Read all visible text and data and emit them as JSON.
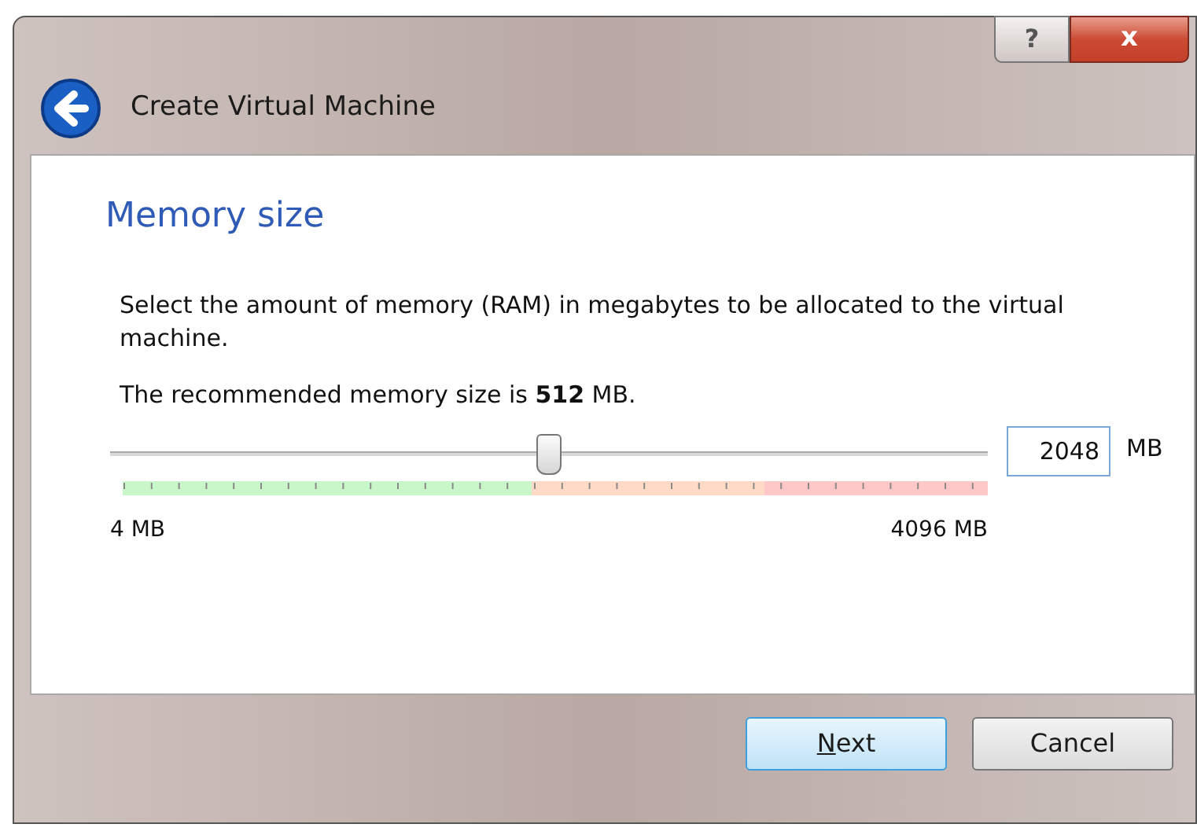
{
  "window": {
    "title": "Create Virtual Machine",
    "help_button": "?",
    "close_button": "x"
  },
  "page": {
    "heading": "Memory size",
    "description": "Select the amount of memory (RAM) in megabytes to be allocated to the virtual machine.",
    "recommendation": "The recommended memory size is **512** MB."
  },
  "memory": {
    "level": 0.5,
    "value": "2048",
    "unit": "MB",
    "min_label": "4 MB",
    "max_label": "4096 MB"
  },
  "buttons": [
    {
      "label": "Next",
      "default": true
    },
    {
      "label": "Cancel",
      "default": false
    }
  ]
}
